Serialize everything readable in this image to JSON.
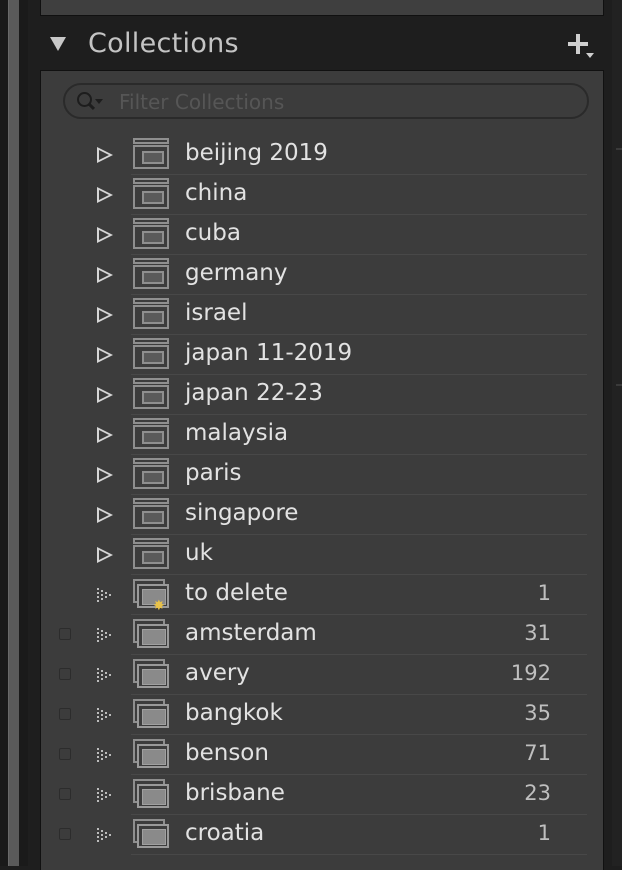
{
  "panel": {
    "title": "Collections",
    "add_icon": "plus-dropdown-icon",
    "collapse_icon": "triangle-down-icon"
  },
  "filter": {
    "placeholder": "Filter Collections",
    "value": "",
    "icon": "search-icon"
  },
  "collection_sets": [
    {
      "label": "beijing 2019"
    },
    {
      "label": "china"
    },
    {
      "label": "cuba"
    },
    {
      "label": "germany"
    },
    {
      "label": "israel"
    },
    {
      "label": "japan 11-2019"
    },
    {
      "label": "japan 22-23"
    },
    {
      "label": "malaysia"
    },
    {
      "label": "paris"
    },
    {
      "label": "singapore"
    },
    {
      "label": "uk"
    }
  ],
  "smart_collection": {
    "label": "to delete",
    "count": "1"
  },
  "collections": [
    {
      "label": "amsterdam",
      "count": "31"
    },
    {
      "label": "avery",
      "count": "192"
    },
    {
      "label": "bangkok",
      "count": "35"
    },
    {
      "label": "benson",
      "count": "71"
    },
    {
      "label": "brisbane",
      "count": "23"
    },
    {
      "label": "croatia",
      "count": "1"
    }
  ],
  "colors": {
    "panel_bg": "#3c3c3c",
    "header_bg": "#1e1e1e",
    "text": "#e2e2e2",
    "smart_badge": "#e8c24a"
  }
}
